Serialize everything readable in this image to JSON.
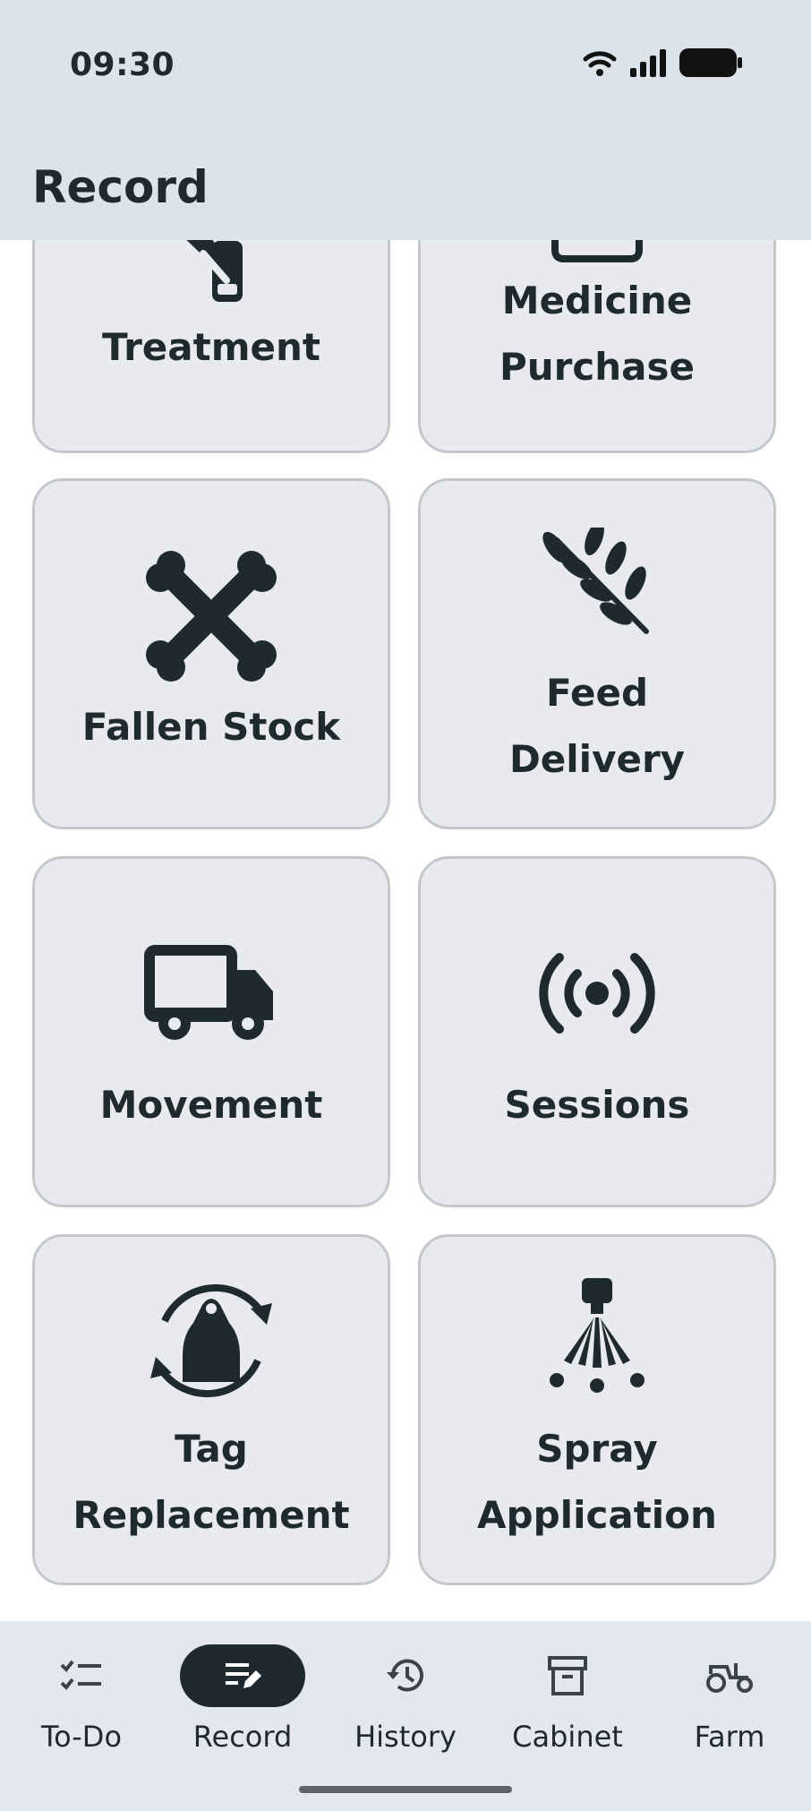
{
  "status_bar": {
    "time": "09:30"
  },
  "header": {
    "title": "Record"
  },
  "tiles": [
    {
      "label_lines": [
        "Treatment"
      ],
      "icon": "syringe-icon"
    },
    {
      "label_lines": [
        "Medicine",
        "Purchase"
      ],
      "icon": "box-icon"
    },
    {
      "label_lines": [
        "Fallen Stock"
      ],
      "icon": "crossed-bones-icon"
    },
    {
      "label_lines": [
        "Feed",
        "Delivery"
      ],
      "icon": "wheat-stalk-icon"
    },
    {
      "label_lines": [
        "Movement"
      ],
      "icon": "truck-icon"
    },
    {
      "label_lines": [
        "Sessions"
      ],
      "icon": "broadcast-signal-icon"
    },
    {
      "label_lines": [
        "Tag",
        "Replacement"
      ],
      "icon": "ear-tag-refresh-icon"
    },
    {
      "label_lines": [
        "Spray",
        "Application"
      ],
      "icon": "spray-nozzle-icon"
    }
  ],
  "nav": {
    "items": [
      {
        "label": "To-Do",
        "icon": "checklist-icon",
        "active": false
      },
      {
        "label": "Record",
        "icon": "edit-note-icon",
        "active": true
      },
      {
        "label": "History",
        "icon": "history-icon",
        "active": false
      },
      {
        "label": "Cabinet",
        "icon": "archive-box-icon",
        "active": false
      },
      {
        "label": "Farm",
        "icon": "tractor-icon",
        "active": false
      }
    ]
  },
  "colors": {
    "header_bg": "#dce3ea",
    "tile_bg": "#e8eaed",
    "tile_border": "#c4c8cc",
    "icon_dark": "#1f2a30",
    "nav_bg": "#e4e8ee"
  }
}
